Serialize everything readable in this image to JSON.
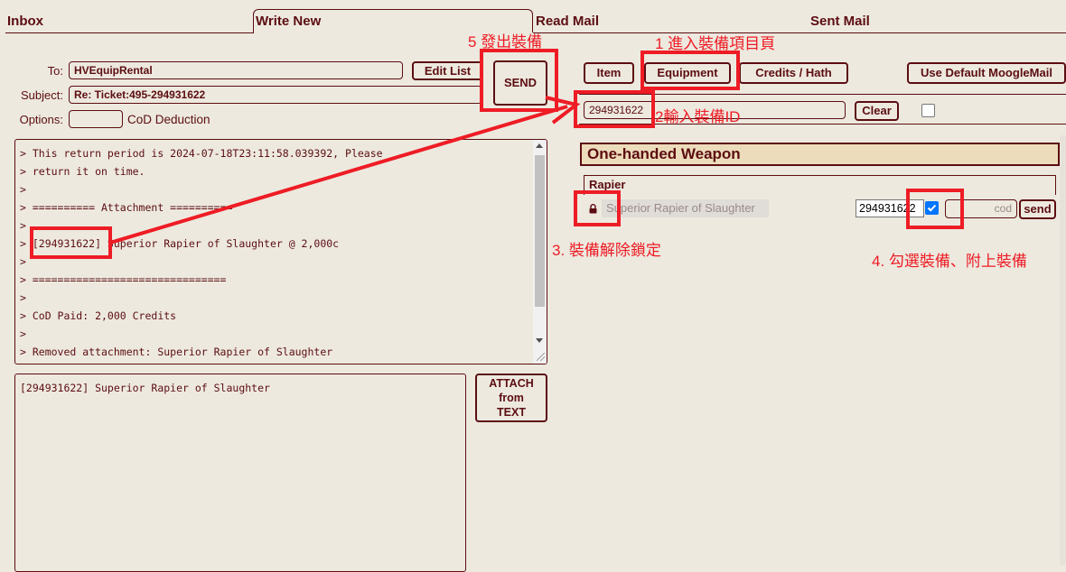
{
  "tabs": {
    "inbox": "Inbox",
    "write_new": "Write New",
    "read_mail": "Read Mail",
    "sent_mail": "Sent Mail"
  },
  "compose": {
    "to_label": "To:",
    "to_value": "HVEquipRental",
    "edit_list": "Edit List",
    "subject_label": "Subject:",
    "subject_value": "Re: Ticket:495-294931622",
    "options_label": "Options:",
    "options_value": "",
    "cod_label": "CoD Deduction",
    "send": "SEND",
    "body_lines": [
      "> This return period is 2024-07-18T23:11:58.039392, Please",
      "> return it on time.",
      ">",
      "> ========== Attachment ==========",
      ">",
      "> [294931622] Superior Rapier of Slaughter @ 2,000c",
      ">",
      "> ===============================",
      ">",
      "> CoD Paid: 2,000 Credits",
      ">",
      "> Removed attachment: Superior Rapier of Slaughter"
    ],
    "attach_text": "[294931622] Superior Rapier of Slaughter",
    "attach_button_lines": [
      "ATTACH",
      "from",
      "TEXT"
    ]
  },
  "attach_panel": {
    "buttons": {
      "item": "Item",
      "equipment": "Equipment",
      "credits": "Credits / Hath",
      "default_moogle": "Use Default MoogleMail"
    },
    "filter_value": "294931622",
    "clear": "Clear",
    "category": "One-handed Weapon",
    "subcategory": "Rapier",
    "item": {
      "lock_icon": "lock-icon",
      "name": "Superior Rapier of Slaughter",
      "id_value": "294931622",
      "checked": true,
      "cod_placeholder": "cod",
      "send": "send"
    }
  },
  "annotations": {
    "step1": "1 進入裝備項目頁",
    "step2": "2輸入裝備ID",
    "step3": "3. 裝備解除鎖定",
    "step4": "4. 勾選裝備、附上裝備",
    "step5": "5 發出裝備",
    "color": "#ee1c25"
  },
  "theme": {
    "text": "#5c0d11",
    "background": "#ede9df",
    "header_fill": "#eddcbb"
  }
}
